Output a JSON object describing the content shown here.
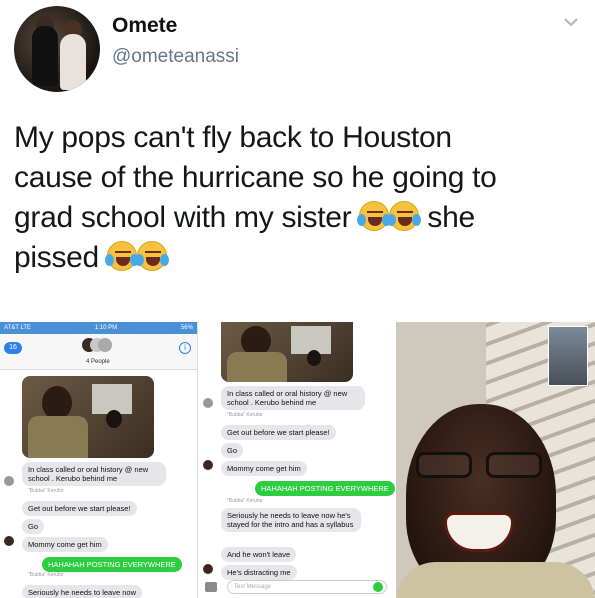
{
  "tweet": {
    "display_name": "Omete",
    "handle": "@ometeanassi",
    "text_line1": "My pops can't fly back to Houston",
    "text_line2": "cause of the hurricane so he going to",
    "text_line3a": "grad school with my sister",
    "text_line3b": "she",
    "text_line4": "pissed"
  },
  "phone1": {
    "carrier": "AT&T  LTE",
    "time": "1:10 PM",
    "battery": "56%",
    "back_count": "16",
    "group_label": "4 People",
    "messages": [
      "In class called or oral history @ new school . Kerubo behind me",
      "Get out before we start please!",
      "Go",
      "Mommy come get him",
      "HAHAHAH POSTING EVERYWHERE",
      "Seriously he needs to leave now"
    ],
    "sender_bubba": "\"Bubba\" Kerubo"
  },
  "phone2": {
    "messages": [
      "In class called or oral history @ new school . Kerubo behind me",
      "Get out before we start please!",
      "Go",
      "Mommy come get him",
      "HAHAHAH POSTING EVERYWHERE",
      "Seriously he needs to leave now he's stayed for the intro and has a syllabus",
      "And he won't leave",
      "He's distracting me"
    ],
    "sender_bubba": "\"Bubba\" Kerubo",
    "input_placeholder": "Text Message"
  },
  "colors": {
    "accent_blue": "#2f80ed",
    "imessage_green": "#2ecc40",
    "bubble_gray": "#e5e5ea"
  }
}
